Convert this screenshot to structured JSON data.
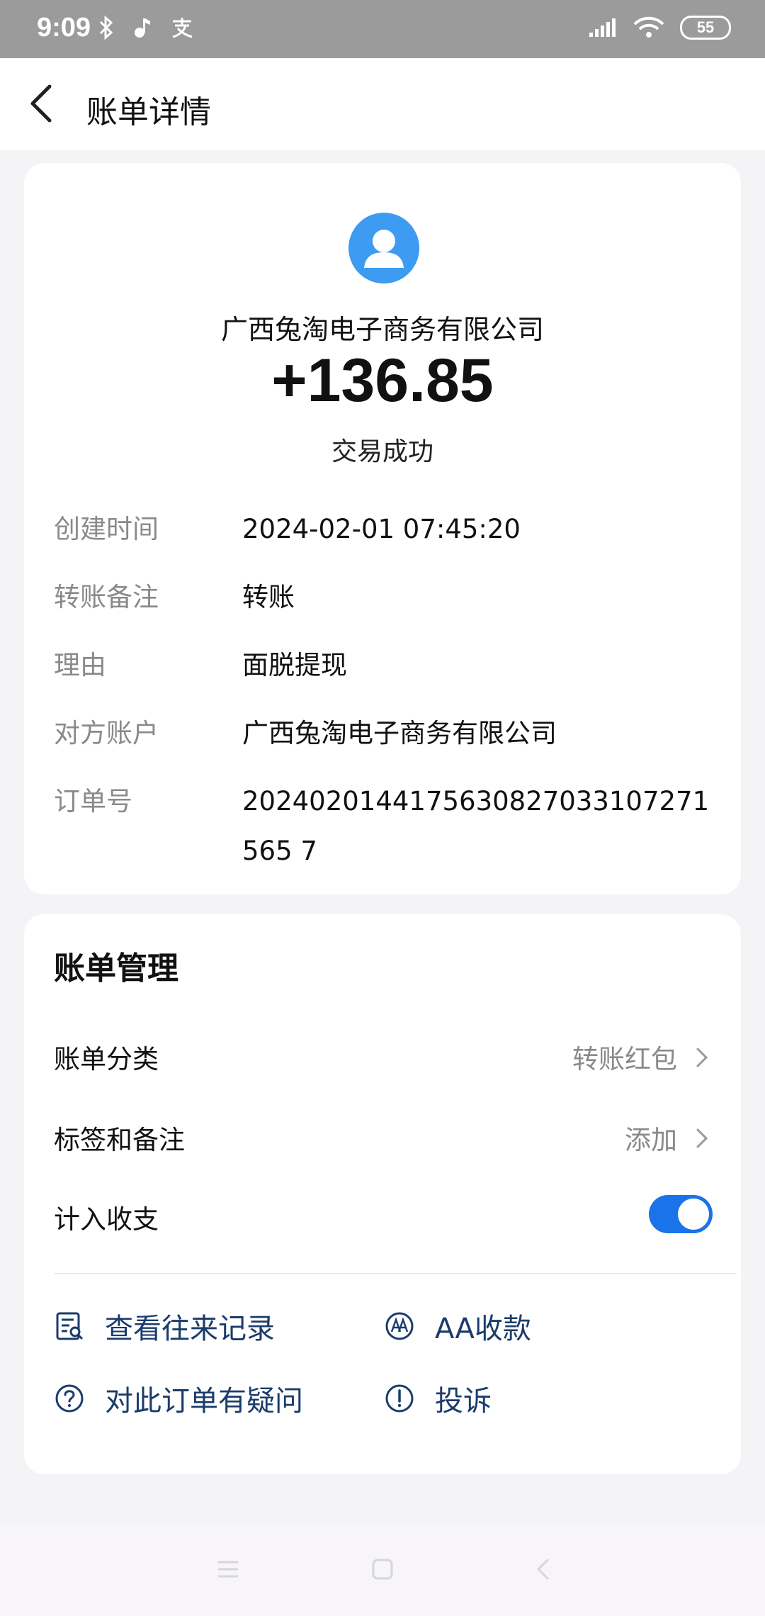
{
  "status_bar": {
    "time": "9:09",
    "battery": "55",
    "icons": [
      "bluetooth-icon",
      "music-icon",
      "alipay-icon",
      "signal-icon",
      "wifi-icon",
      "battery-icon"
    ]
  },
  "header": {
    "title": "账单详情"
  },
  "transaction": {
    "payee": "广西兔淘电子商务有限公司",
    "amount": "+136.85",
    "status": "交易成功",
    "details": [
      {
        "label": "创建时间",
        "value": "2024-02-01 07:45:20"
      },
      {
        "label": "转账备注",
        "value": "转账"
      },
      {
        "label": "理由",
        "value": "面脱提现"
      },
      {
        "label": "对方账户",
        "value": "广西兔淘电子商务有限公司"
      },
      {
        "label": "订单号",
        "value": "2024020144175630827033107271565 7"
      }
    ]
  },
  "management": {
    "title": "账单管理",
    "category_label": "账单分类",
    "category_value": "转账红包",
    "tags_label": "标签和备注",
    "tags_value": "添加",
    "include_label": "计入收支",
    "include_enabled": true,
    "actions": [
      {
        "label": "查看往来记录",
        "icon": "records-icon"
      },
      {
        "label": "AA收款",
        "icon": "aa-icon"
      },
      {
        "label": "对此订单有疑问",
        "icon": "question-icon"
      },
      {
        "label": "投诉",
        "icon": "complaint-icon"
      }
    ]
  },
  "colors": {
    "accent": "#1a73e8",
    "action_text": "#1b3c6b",
    "avatar_bg": "#3e9bf2",
    "muted_text": "#8a8a8a"
  }
}
